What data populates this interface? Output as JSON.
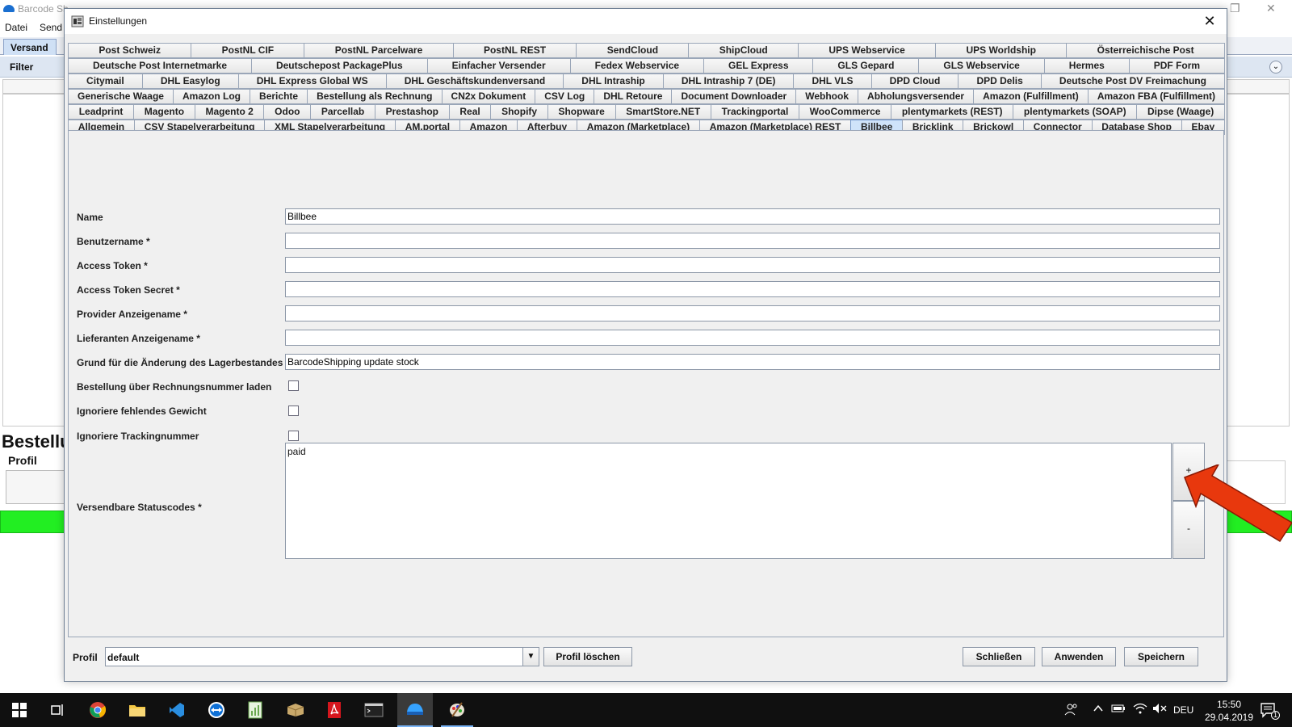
{
  "bg_app": {
    "title": "Barcode Sh",
    "menu": [
      "Datei",
      "Send"
    ],
    "tab_versand": "Versand",
    "filter_label": "Filter",
    "bestell_text": "Bestellu",
    "profil_text": "Profil",
    "status_color": "#22ee22"
  },
  "dialog": {
    "title": "Einstellungen",
    "tab_rows": [
      [
        "Post Schweiz",
        "PostNL CIF",
        "PostNL Parcelware",
        "PostNL REST",
        "SendCloud",
        "ShipCloud",
        "UPS Webservice",
        "UPS Worldship",
        "Österreichische Post"
      ],
      [
        "Deutsche Post Internetmarke",
        "Deutschepost PackagePlus",
        "Einfacher Versender",
        "Fedex Webservice",
        "GEL Express",
        "GLS Gepard",
        "GLS Webservice",
        "Hermes",
        "PDF Form"
      ],
      [
        "Citymail",
        "DHL Easylog",
        "DHL Express Global WS",
        "DHL Geschäftskundenversand",
        "DHL Intraship",
        "DHL Intraship 7 (DE)",
        "DHL VLS",
        "DPD Cloud",
        "DPD Delis",
        "Deutsche Post DV Freimachung"
      ],
      [
        "Generische Waage",
        "Amazon Log",
        "Berichte",
        "Bestellung als Rechnung",
        "CN2x Dokument",
        "CSV Log",
        "DHL Retoure",
        "Document Downloader",
        "Webhook",
        "Abholungsversender",
        "Amazon (Fulfillment)",
        "Amazon FBA (Fulfillment)"
      ],
      [
        "Leadprint",
        "Magento",
        "Magento 2",
        "Odoo",
        "Parcellab",
        "Prestashop",
        "Real",
        "Shopify",
        "Shopware",
        "SmartStore.NET",
        "Trackingportal",
        "WooCommerce",
        "plentymarkets (REST)",
        "plentymarkets (SOAP)",
        "Dipse (Waage)"
      ],
      [
        "Allgemein",
        "CSV Stapelverarbeitung",
        "XML Stapelverarbeitung",
        "AM.portal",
        "Amazon",
        "Afterbuy",
        "Amazon (Marketplace)",
        "Amazon (Marketplace) REST",
        "Billbee",
        "Bricklink",
        "Brickowl",
        "Connector",
        "Database Shop",
        "Ebay"
      ]
    ],
    "active_tab": "Billbee",
    "fields": {
      "name_label": "Name",
      "name_value": "Billbee",
      "benutzer_label": "Benutzername *",
      "benutzer_value": "",
      "token_label": "Access Token *",
      "token_value": "",
      "secret_label": "Access Token Secret *",
      "secret_value": "",
      "provider_label": "Provider Anzeigename *",
      "provider_value": "",
      "lieferant_label": "Lieferanten Anzeigename *",
      "lieferant_value": "",
      "grund_label": "Grund für die Änderung des Lagerbestandes",
      "grund_value": "BarcodeShipping update stock",
      "rechnung_label": "Bestellung über Rechnungsnummer laden",
      "rechnung_checked": false,
      "gewicht_label": "Ignoriere fehlendes Gewicht",
      "gewicht_checked": false,
      "tracking_label": "Ignoriere Trackingnummer",
      "tracking_checked": false,
      "status_label": "Versendbare Statuscodes *",
      "status_items": [
        "paid"
      ],
      "add_label": "+",
      "remove_label": "-"
    },
    "footer": {
      "profil_label": "Profil",
      "profil_value": "default",
      "delete_label": "Profil löschen",
      "close_label": "Schließen",
      "apply_label": "Anwenden",
      "save_label": "Speichern"
    }
  },
  "annotation": {
    "arrow_color": "#e8380d"
  },
  "taskbar": {
    "apps": [
      "windows-start-icon",
      "task-view-icon",
      "chrome-icon",
      "file-explorer-icon",
      "vscode-icon",
      "teamviewer-icon",
      "spreadsheet-icon",
      "package-icon",
      "acrobat-icon",
      "terminal-icon",
      "barcode-shipping-icon",
      "paint-icon"
    ],
    "lang": "DEU",
    "time": "15:50",
    "date": "29.04.2019",
    "notifications": "1"
  }
}
